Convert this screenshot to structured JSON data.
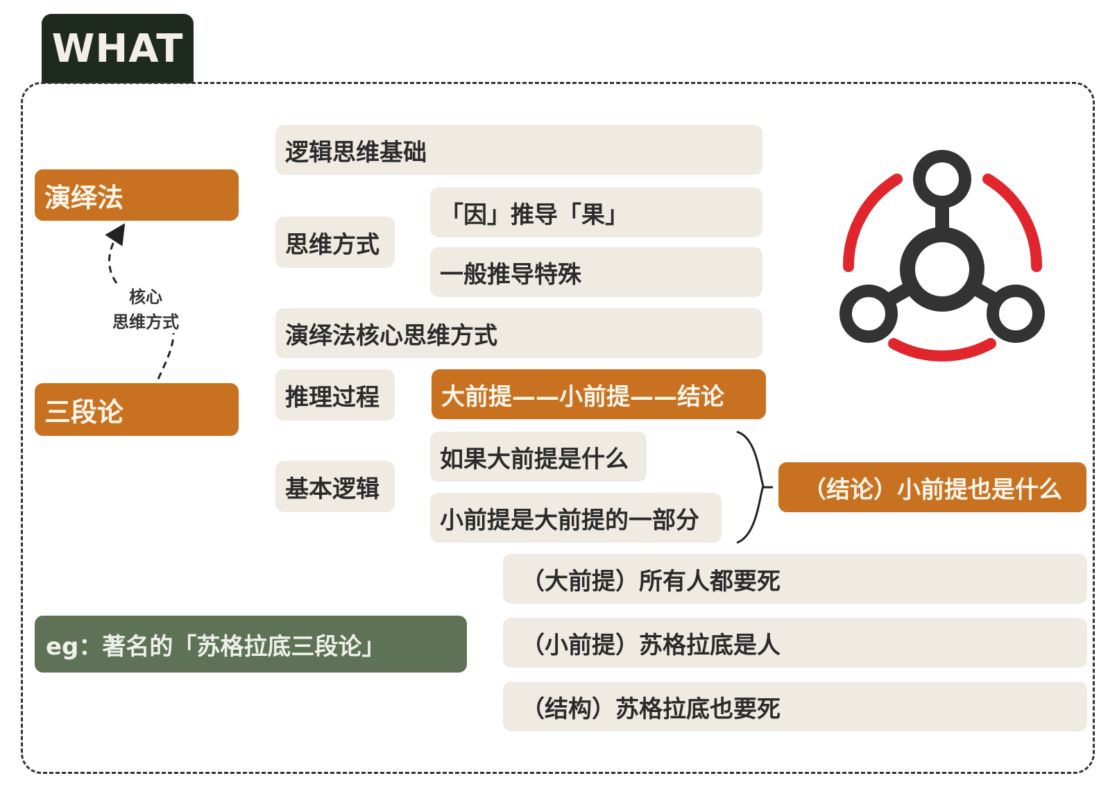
{
  "tab": {
    "title": "WHAT"
  },
  "left": {
    "deduction": "演绎法",
    "syllogism": "三段论",
    "relation_note_line1": "核心",
    "relation_note_line2": "思维方式",
    "example": "eg：著名的「苏格拉底三段论」"
  },
  "rows": {
    "logic_basis": "逻辑思维基础",
    "thinking_label": "思维方式",
    "thinking_1": "「因」推导「果」",
    "thinking_2": "一般推导特殊",
    "core_method": "演绎法核心思维方式",
    "reasoning_label": "推理过程",
    "reasoning_value": "大前提——小前提——结论",
    "basic_label": "基本逻辑",
    "basic_1": "如果大前提是什么",
    "basic_2": "小前提是大前提的一部分",
    "conclusion": "（结论）小前提也是什么"
  },
  "examples": {
    "major": "（大前提）所有人都要死",
    "minor": "（小前提）苏格拉底是人",
    "result": "（结构）苏格拉底也要死"
  },
  "icon": {
    "name": "network-hub-icon",
    "ring_color": "#e0262c",
    "node_color": "#333333"
  },
  "colors": {
    "orange": "#c87221",
    "beige": "#efebe2",
    "green": "#5e7256",
    "dark": "#1f2a1f"
  }
}
